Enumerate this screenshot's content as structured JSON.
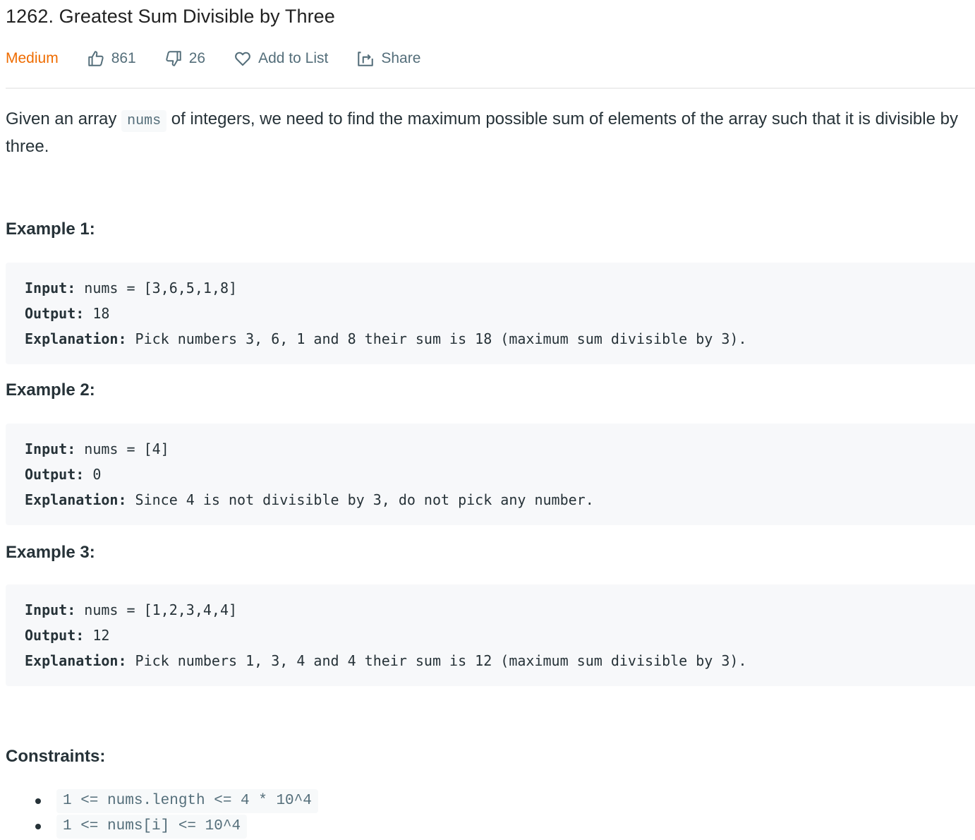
{
  "problem": {
    "title": "1262. Greatest Sum Divisible by Three",
    "difficulty": "Medium",
    "likes": "861",
    "dislikes": "26",
    "add_to_list_label": "Add to List",
    "share_label": "Share"
  },
  "description": {
    "before_code": "Given an array ",
    "code": "nums",
    "after_code": " of integers, we need to find the maximum possible sum of elements of the array such that it is divisible by three."
  },
  "examples": [
    {
      "heading": "Example 1:",
      "input_label": "Input:",
      "input_value": " nums = [3,6,5,1,8]",
      "output_label": "Output:",
      "output_value": " 18",
      "explanation_label": "Explanation:",
      "explanation_value": " Pick numbers 3, 6, 1 and 8 their sum is 18 (maximum sum divisible by 3)."
    },
    {
      "heading": "Example 2:",
      "input_label": "Input:",
      "input_value": " nums = [4]",
      "output_label": "Output:",
      "output_value": " 0",
      "explanation_label": "Explanation:",
      "explanation_value": " Since 4 is not divisible by 3, do not pick any number."
    },
    {
      "heading": "Example 3:",
      "input_label": "Input:",
      "input_value": " nums = [1,2,3,4,4]",
      "output_label": "Output:",
      "output_value": " 12",
      "explanation_label": "Explanation:",
      "explanation_value": " Pick numbers 1, 3, 4 and 4 their sum is 12 (maximum sum divisible by 3)."
    }
  ],
  "constraints": {
    "heading": "Constraints:",
    "items": [
      "1 <= nums.length <= 4 * 10^4",
      "1 <= nums[i] <= 10^4"
    ]
  },
  "colors": {
    "difficulty_medium": "#ef6c00",
    "meta_text": "#546e7a",
    "code_bg": "#f7f8fa"
  }
}
